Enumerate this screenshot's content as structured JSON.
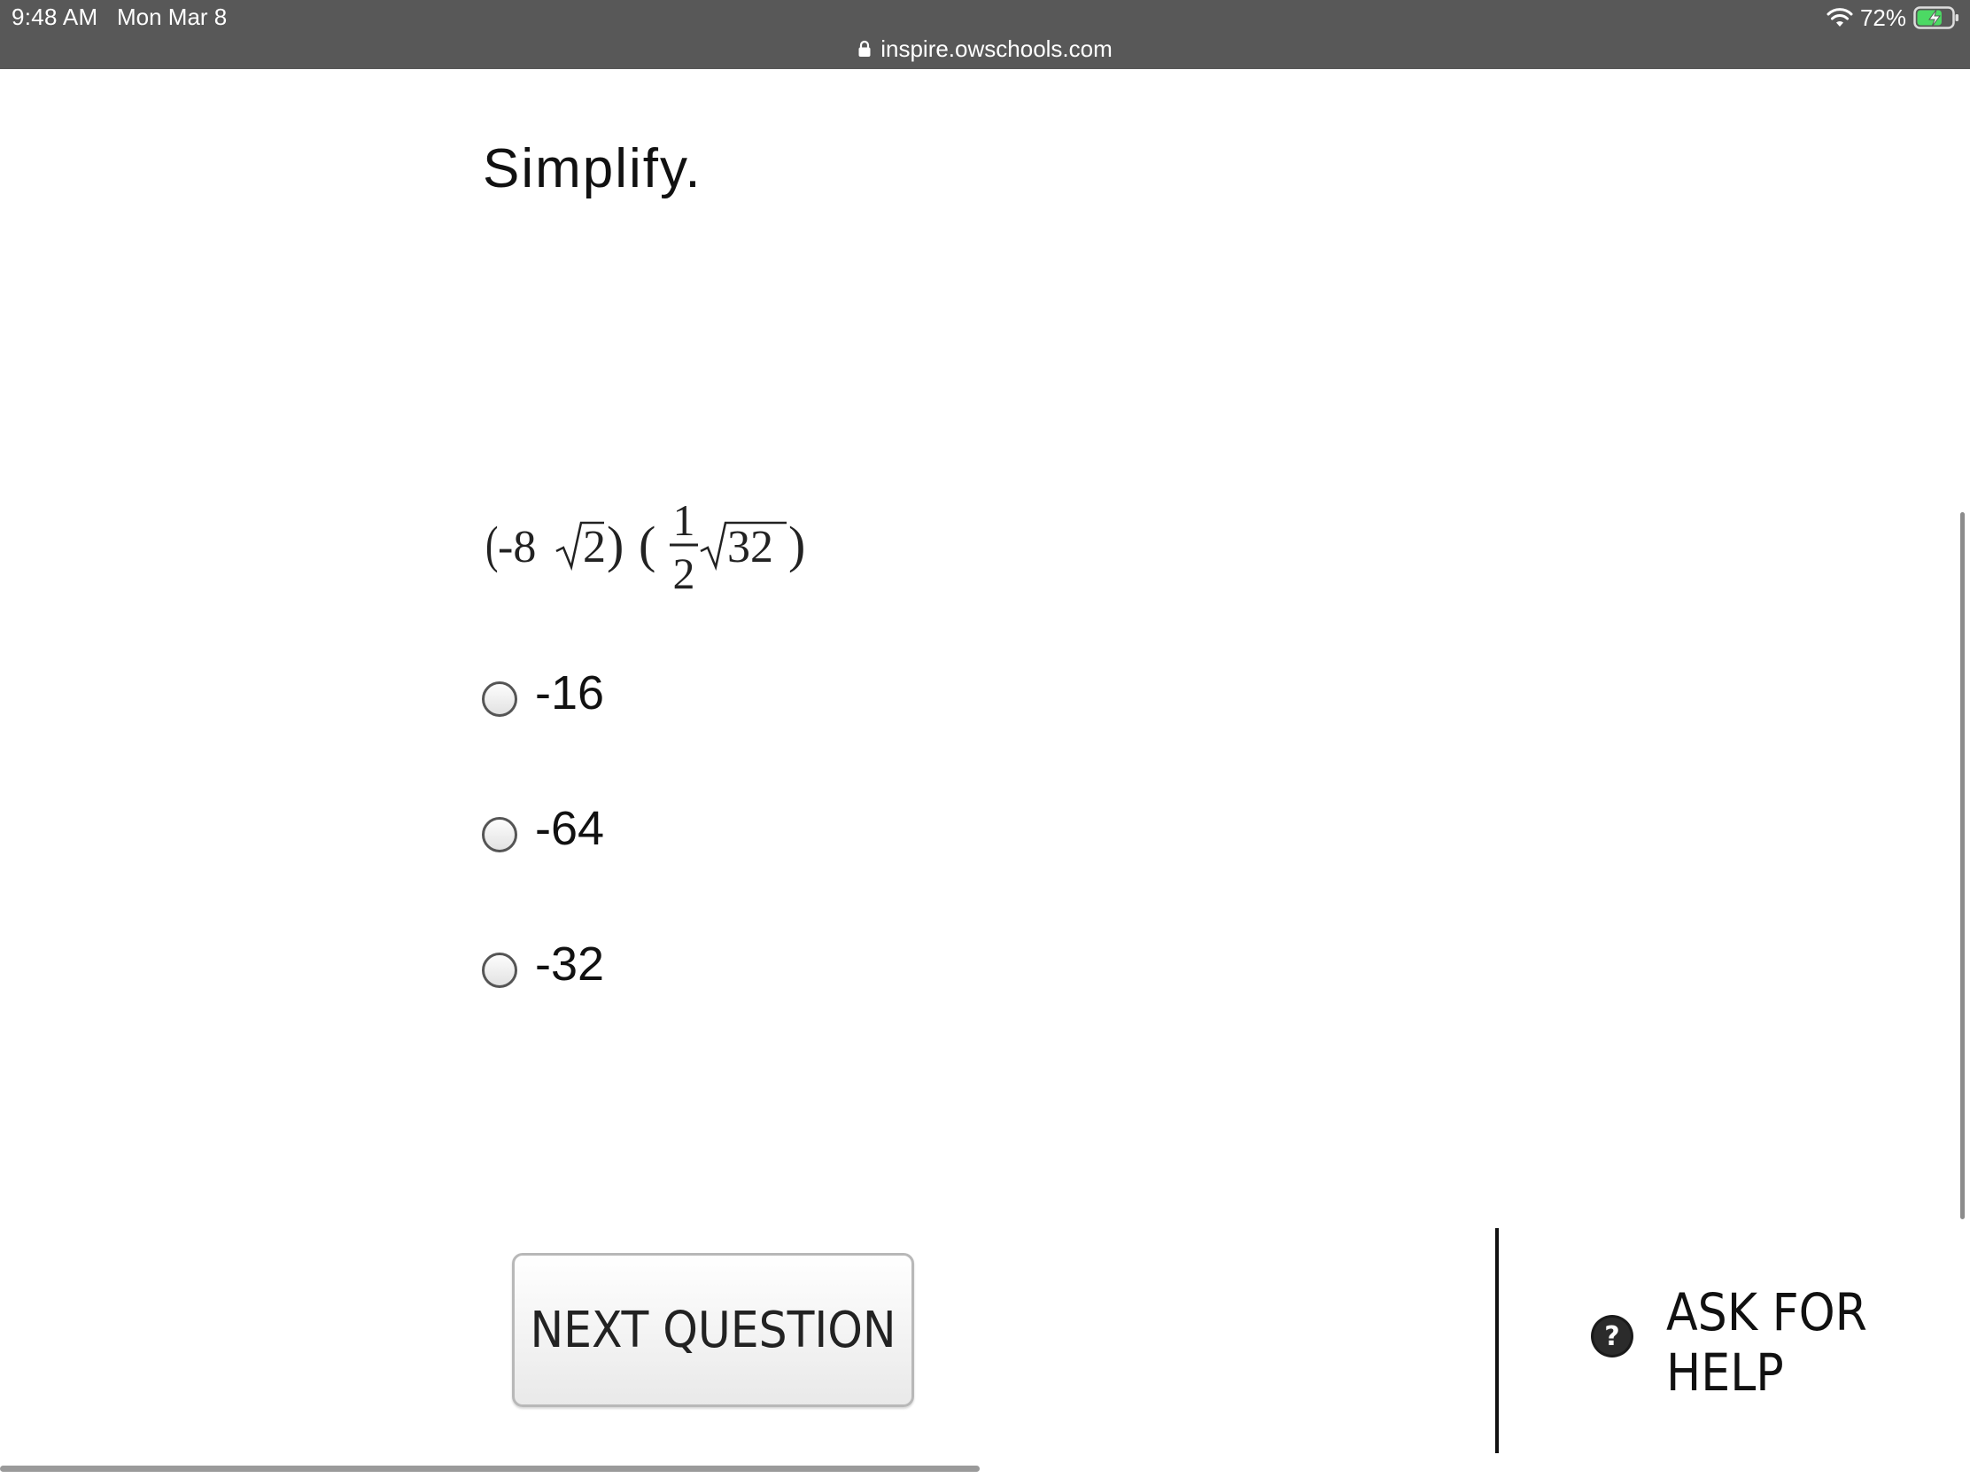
{
  "status_bar": {
    "time": "9:48 AM",
    "date": "Mon Mar 8",
    "battery_percent": "72%",
    "wifi_icon": "wifi-icon",
    "battery_icon": "battery-charging-icon",
    "battery_level": 0.72
  },
  "browser": {
    "url": "inspire.owschools.com",
    "lock_icon": "lock-icon"
  },
  "question": {
    "title": "Simplify.",
    "expression": {
      "open_paren_1": "(",
      "coef": "-8",
      "radicand_1": "2",
      "close_paren_1": ")",
      "open_paren_2": "(",
      "frac_num": "1",
      "frac_den": "2",
      "radicand_2": "32",
      "close_paren_2": ")"
    },
    "choices": [
      {
        "label": "-16"
      },
      {
        "label": "-64"
      },
      {
        "label": "-32"
      }
    ]
  },
  "actions": {
    "next_label": "NEXT QUESTION",
    "help_label": "ASK FOR HELP",
    "help_icon": "question-circle-icon"
  },
  "colors": {
    "status_bar_bg": "#585858",
    "text": "#111111",
    "button_border": "#b8b8b8"
  }
}
